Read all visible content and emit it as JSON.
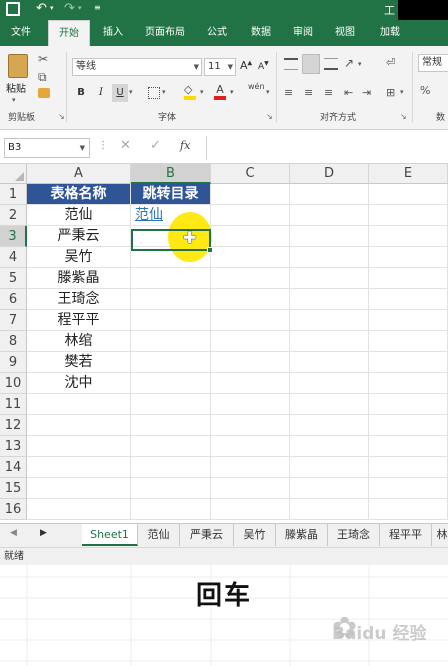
{
  "titlebar": {
    "title_fragment": "工"
  },
  "ribbon_tabs": [
    "文件",
    "开始",
    "插入",
    "页面布局",
    "公式",
    "数据",
    "审阅",
    "视图",
    "加载"
  ],
  "ribbon": {
    "paste_label": "粘贴",
    "clipboard_label": "剪贴板",
    "font_name": "等线",
    "font_size": "11",
    "font_group_label": "字体",
    "bold": "B",
    "italic": "I",
    "underline": "U",
    "wen": "wén",
    "align_group_label": "对齐方式",
    "number_format": "常规",
    "number_group_label": "数"
  },
  "formula_bar": {
    "name_box": "B3",
    "fx": "fx",
    "formula": ""
  },
  "columns": [
    "A",
    "B",
    "C",
    "D",
    "E"
  ],
  "rows": [
    "1",
    "2",
    "3",
    "4",
    "5",
    "6",
    "7",
    "8",
    "9",
    "10",
    "11",
    "12",
    "13",
    "14",
    "15",
    "16"
  ],
  "cells": {
    "A1": "表格名称",
    "B1": "跳转目录",
    "A2": "范仙",
    "B2": "范仙",
    "A3": "严秉云",
    "A4": "吴竹",
    "A5": "滕紫晶",
    "A6": "王琦念",
    "A7": "程平平",
    "A8": "林绾",
    "A9": "樊若",
    "A10": "沈中"
  },
  "sheet_tabs": [
    "Sheet1",
    "范仙",
    "严秉云",
    "吴竹",
    "滕紫晶",
    "王琦念",
    "程平平",
    "林"
  ],
  "active_sheet": "Sheet1",
  "status": "就绪",
  "caption": "回车",
  "watermark": "Baidu 经验",
  "colors": {
    "excel_green": "#217346",
    "header_fill": "#2f5597",
    "link_blue": "#2e75b6",
    "highlight": "#ffe600"
  }
}
